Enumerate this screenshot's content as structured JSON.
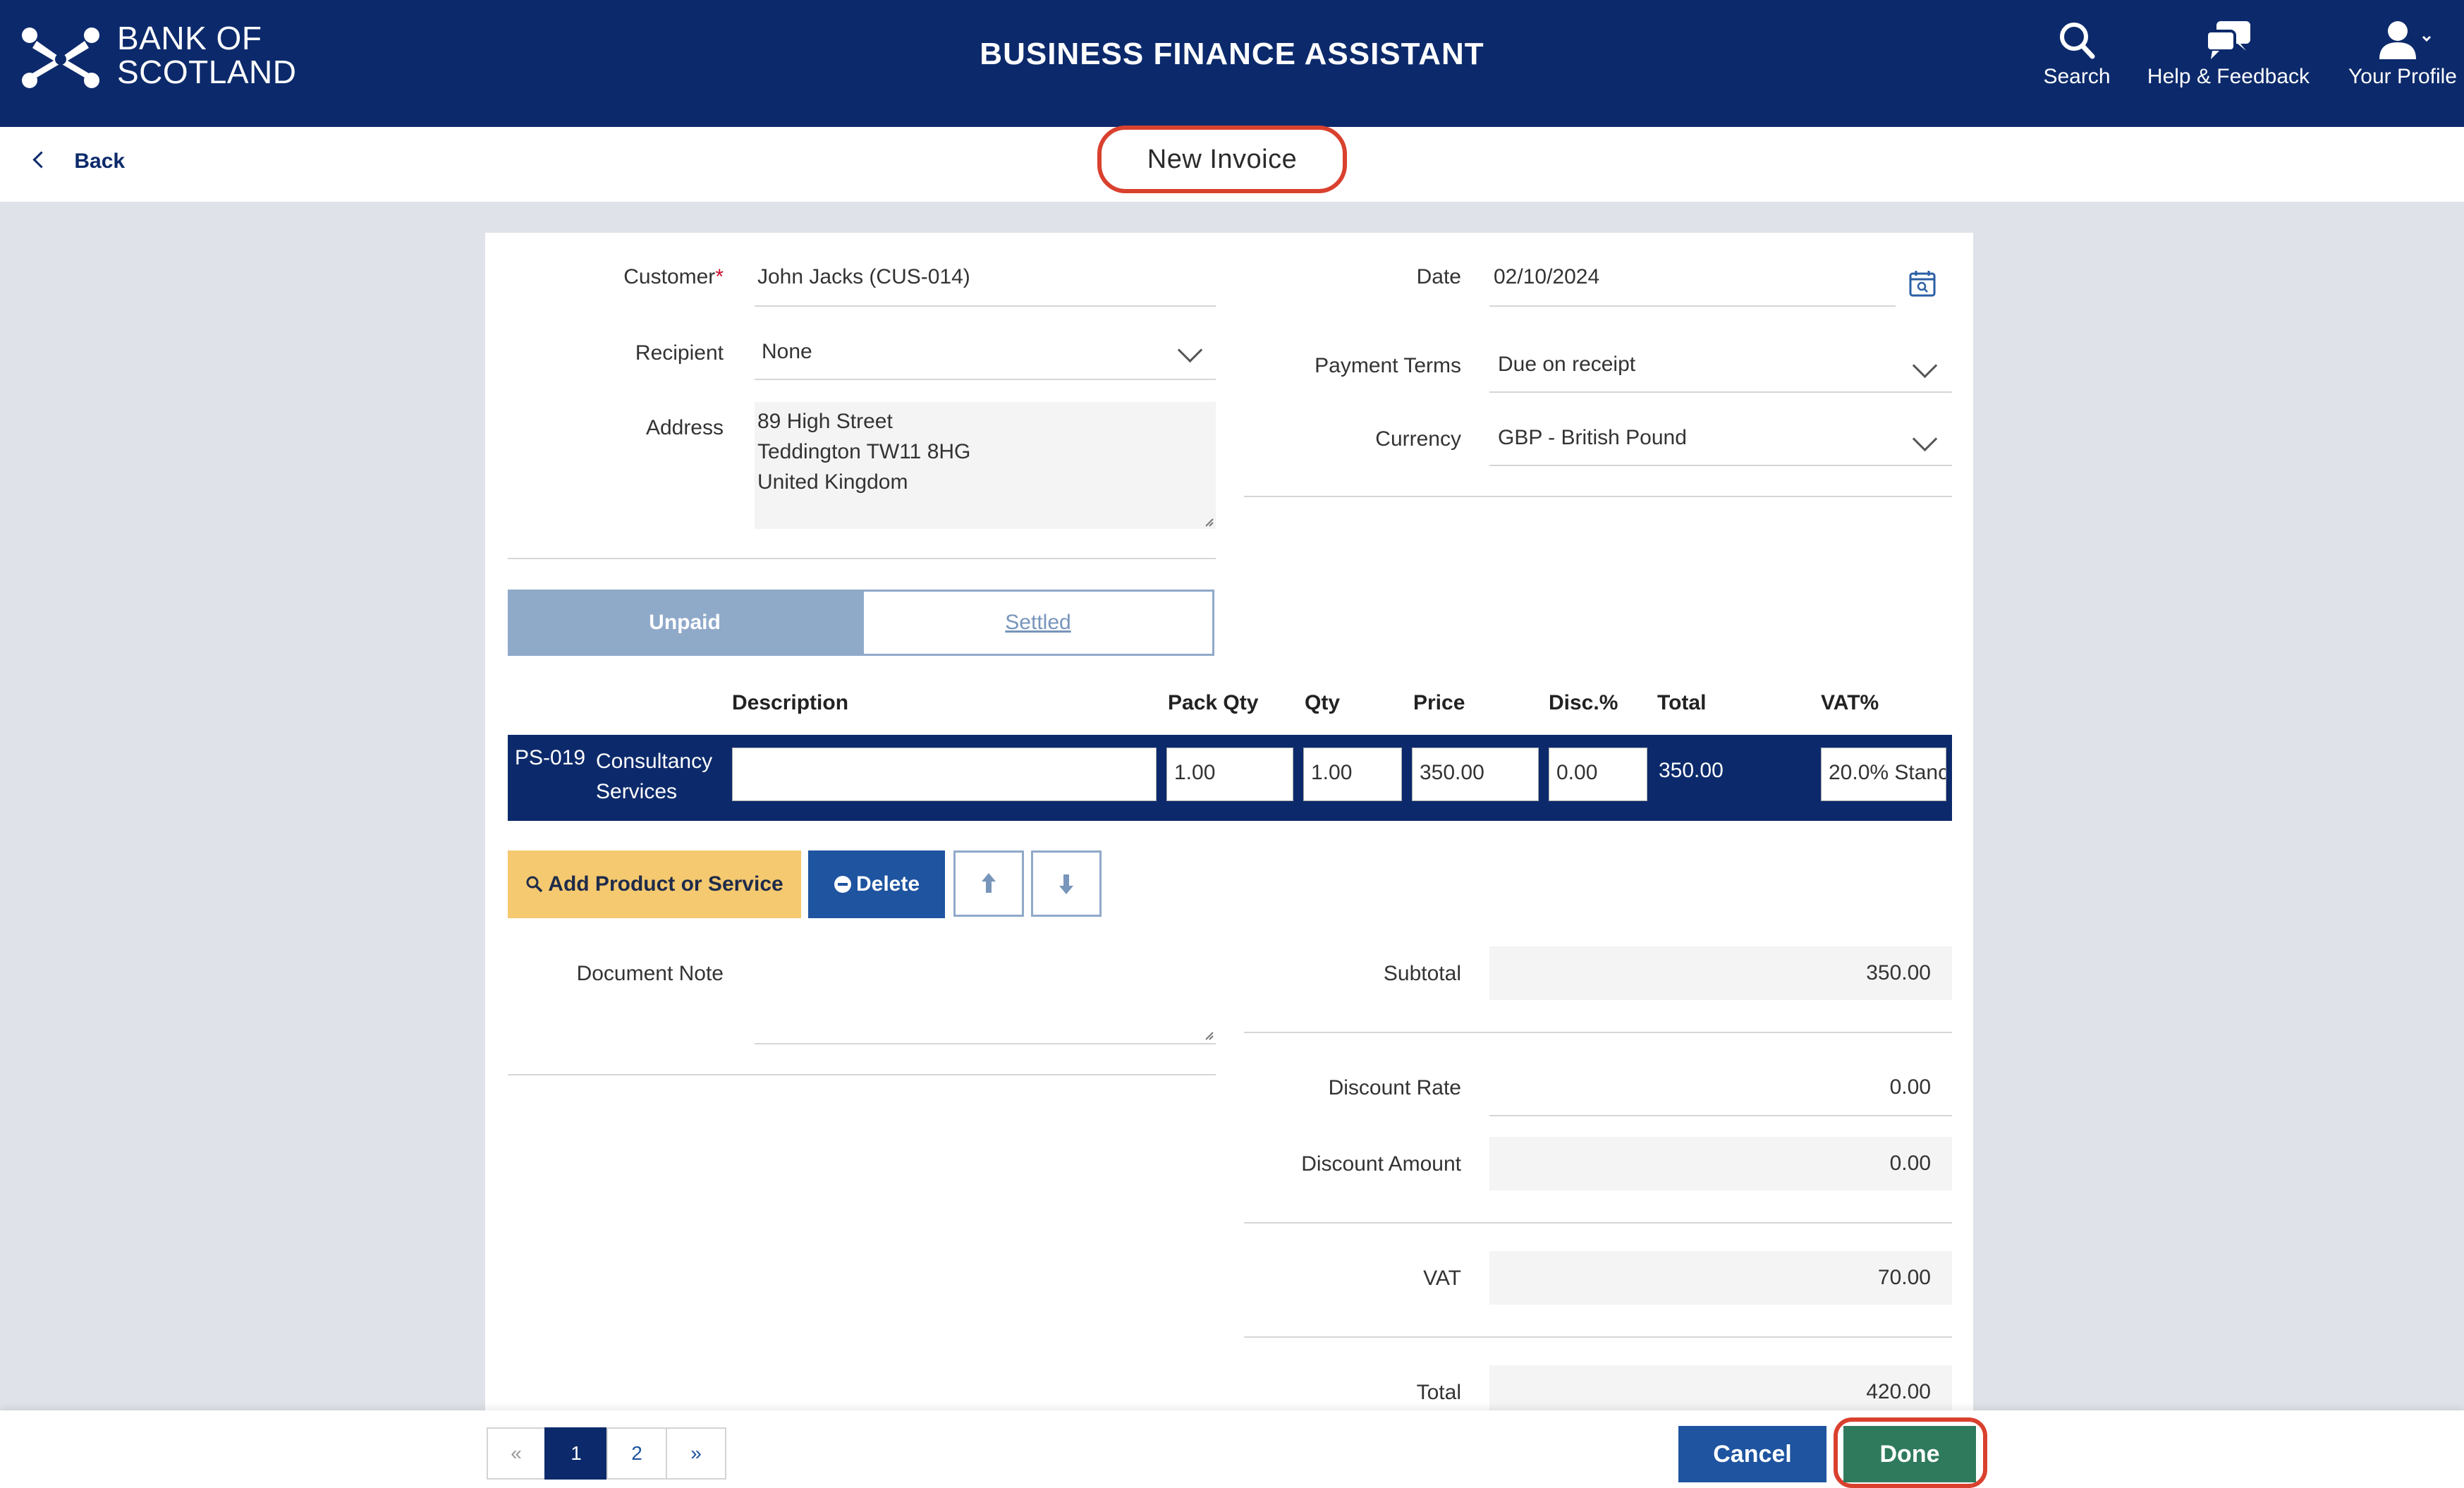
{
  "header": {
    "brand": "BANK OF SCOTLAND",
    "brand_line1": "BANK OF",
    "brand_line2": "SCOTLAND",
    "app_title": "BUSINESS FINANCE ASSISTANT",
    "search_label": "Search",
    "help_label": "Help & Feedback",
    "profile_label": "Your Profile"
  },
  "subheader": {
    "back_label": "Back",
    "page_title": "New Invoice"
  },
  "form": {
    "customer_label": "Customer",
    "customer_required_mark": "*",
    "customer_value": "John Jacks (CUS-014)",
    "recipient_label": "Recipient",
    "recipient_value": "None",
    "address_label": "Address",
    "address_line1": "89 High Street",
    "address_line2": "Teddington TW11 8HG",
    "address_line3": "United Kingdom",
    "date_label": "Date",
    "date_value": "02/10/2024",
    "payment_terms_label": "Payment Terms",
    "payment_terms_value": "Due on receipt",
    "currency_label": "Currency",
    "currency_value": "GBP - British Pound"
  },
  "status_tabs": {
    "unpaid": "Unpaid",
    "settled": "Settled"
  },
  "table": {
    "headers": {
      "description": "Description",
      "pack_qty": "Pack Qty",
      "qty": "Qty",
      "price": "Price",
      "disc": "Disc.%",
      "total": "Total",
      "vat": "VAT%"
    },
    "rows": [
      {
        "code": "PS-019",
        "name_line1": "Consultancy",
        "name_line2": "Services",
        "description": "",
        "pack_qty": "1.00",
        "qty": "1.00",
        "price": "350.00",
        "disc": "0.00",
        "total": "350.00",
        "vat": "20.0% Stanc"
      }
    ]
  },
  "actions": {
    "add_label": "Add Product or Service",
    "delete_label": "Delete"
  },
  "note": {
    "label": "Document Note",
    "value": ""
  },
  "summary": {
    "subtotal_label": "Subtotal",
    "subtotal_value": "350.00",
    "discount_rate_label": "Discount Rate",
    "discount_rate_value": "0.00",
    "discount_amount_label": "Discount Amount",
    "discount_amount_value": "0.00",
    "vat_label": "VAT",
    "vat_value": "70.00",
    "total_label": "Total",
    "total_value": "420.00"
  },
  "footer": {
    "pagination": {
      "prev": "«",
      "pages": [
        "1",
        "2"
      ],
      "current": "1",
      "next": "»"
    },
    "cancel_label": "Cancel",
    "done_label": "Done"
  },
  "colors": {
    "brand_navy": "#0c2a6b",
    "accent_blue": "#1e54a0",
    "add_yellow": "#f5c96f",
    "done_green": "#2f7a5c",
    "highlight_red": "#d9412e"
  }
}
